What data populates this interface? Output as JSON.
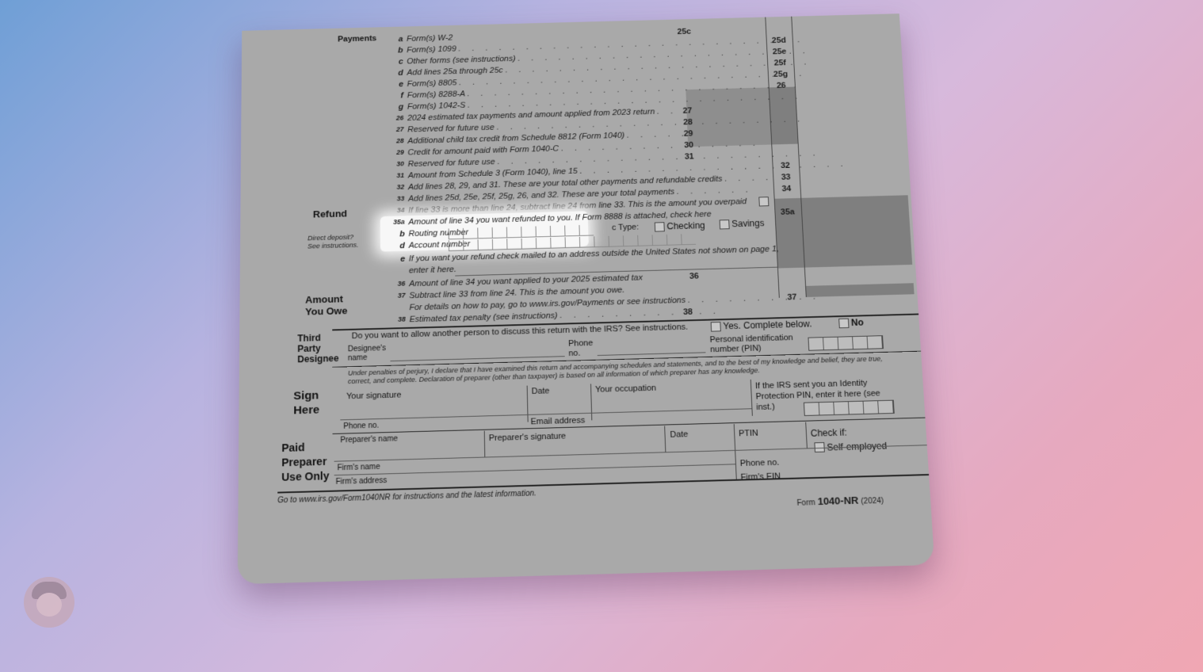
{
  "payments": {
    "heading": "Payments",
    "lines": [
      {
        "letter": "a",
        "text": "Form(s) W-2",
        "no": "25c"
      },
      {
        "letter": "b",
        "text": "Form(s) 1099",
        "no": "25d"
      },
      {
        "letter": "c",
        "text": "Other forms (see instructions)",
        "no": "25e"
      },
      {
        "letter": "d",
        "text": "Add lines 25a through 25c",
        "no": "25f"
      },
      {
        "letter": "e",
        "text": "Form(s) 8805",
        "no": "25g"
      },
      {
        "letter": "f",
        "text": "Form(s) 8288-A",
        "no": "26"
      },
      {
        "letter": "g",
        "text": "Form(s) 1042-S",
        "no": ""
      },
      {
        "letter": "26",
        "text": "2024 estimated tax payments and amount applied from 2023 return",
        "no": "27"
      },
      {
        "letter": "27",
        "text": "Reserved for future use",
        "no": "28"
      },
      {
        "letter": "28",
        "text": "Additional child tax credit from Schedule 8812 (Form 1040)",
        "no": "29"
      },
      {
        "letter": "29",
        "text": "Credit for amount paid with Form 1040-C",
        "no": "30"
      },
      {
        "letter": "30",
        "text": "Reserved for future use",
        "no": "31"
      },
      {
        "letter": "31",
        "text": "Amount from Schedule 3 (Form 1040), line 15",
        "no": "32"
      },
      {
        "letter": "32",
        "text": "Add lines 28, 29, and 31. These are your total other payments and refundable credits",
        "no": "33"
      },
      {
        "letter": "33",
        "text": "Add lines 25d, 25e, 25f, 25g, 26, and 32. These are your total payments",
        "no": "34"
      }
    ]
  },
  "refund": {
    "heading": "Refund",
    "line34": "If line 33 is more than line 24, subtract line 24 from line 33. This is the amount you overpaid",
    "line35a": "Amount of line 34 you want refunded to you. If Form 8888 is attached, check here",
    "line35a_no": "35a",
    "routing_label": "Routing number",
    "account_label": "Account number",
    "type_label": "c Type:",
    "checking": "Checking",
    "savings": "Savings",
    "direct_deposit_note": "Direct deposit? See instructions.",
    "line_e": "If you want your refund check mailed to an address outside the United States not shown on page 1,",
    "line_e2": "enter it here.",
    "line36": "Amount of line 34 you want applied to your 2025 estimated tax",
    "line36_no": "36"
  },
  "amount_owe": {
    "heading1": "Amount",
    "heading2": "You Owe",
    "line37": "Subtract line 33 from line 24. This is the amount you owe.",
    "line37b": "For details on how to pay, go to www.irs.gov/Payments or see instructions",
    "line37_no": "37",
    "line38": "Estimated tax penalty (see instructions)",
    "line38_no": "38"
  },
  "third_party": {
    "heading": "Third Party Designee",
    "question": "Do you want to allow another person to discuss this return with the IRS? See instructions.",
    "yes": "Yes. Complete below.",
    "no": "No",
    "designee_name": "Designee's name",
    "phone": "Phone no.",
    "pin": "Personal identification number (PIN)"
  },
  "sign": {
    "heading1": "Sign",
    "heading2": "Here",
    "perjury": "Under penalties of perjury, I declare that I have examined this return and accompanying schedules and statements, and to the best of my knowledge and belief, they are true, correct, and complete. Declaration of preparer (other than taxpayer) is based on all information of which preparer has any knowledge.",
    "your_signature": "Your signature",
    "date": "Date",
    "occupation": "Your occupation",
    "ip_pin": "If the IRS sent you an Identity Protection PIN, enter it here (see inst.)",
    "phone": "Phone no.",
    "email": "Email address"
  },
  "preparer": {
    "heading": "Paid Preparer Use Only",
    "name": "Preparer's name",
    "signature": "Preparer's signature",
    "date": "Date",
    "ptin": "PTIN",
    "check_if": "Check if:",
    "self_employed": "Self-employed",
    "firm_name": "Firm's name",
    "firm_address": "Firm's address",
    "phone": "Phone no.",
    "firm_ein": "Firm's EIN"
  },
  "footer": {
    "goto": "Go to www.irs.gov/Form1040NR for instructions and the latest information.",
    "form_prefix": "Form",
    "form_name": "1040-NR",
    "year": "(2024)"
  }
}
